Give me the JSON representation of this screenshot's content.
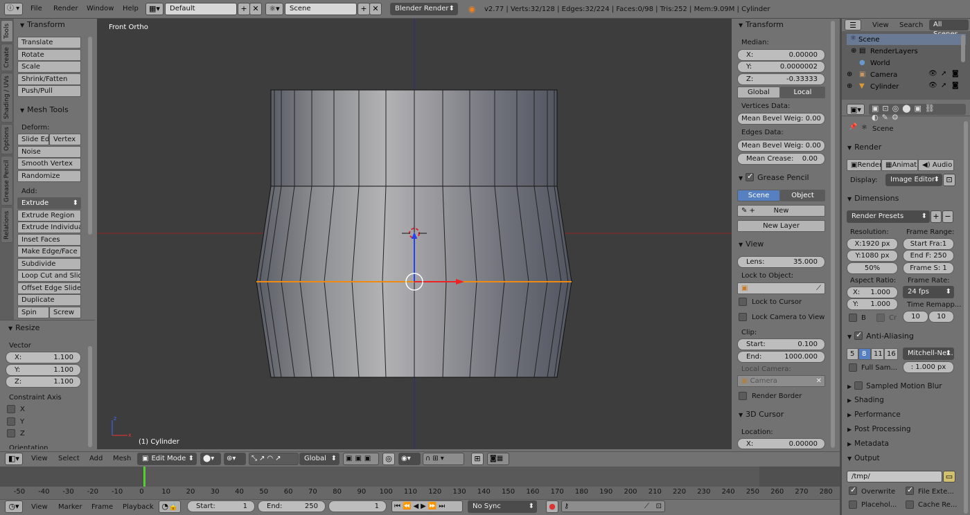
{
  "topbar": {
    "menus": [
      "File",
      "Render",
      "Window",
      "Help"
    ],
    "screen_layout": "Default",
    "scene": "Scene",
    "engine": "Blender Render",
    "stats": "v2.77 | Verts:32/128 | Edges:32/224 | Faces:0/98 | Tris:252 | Mem:9.09M | Cylinder"
  },
  "vtabs": [
    "Tools",
    "Create",
    "Shading / UVs",
    "Options",
    "Grease Pencil",
    "Relations"
  ],
  "toolshelf": {
    "transform_title": "Transform",
    "transform_buttons": [
      "Translate",
      "Rotate",
      "Scale",
      "Shrink/Fatten",
      "Push/Pull"
    ],
    "mesh_tools_title": "Mesh Tools",
    "deform_label": "Deform:",
    "slide_edge": "Slide Ed",
    "vertex": "Vertex",
    "deform_buttons": [
      "Noise",
      "Smooth Vertex",
      "Randomize"
    ],
    "add_label": "Add:",
    "extrude": "Extrude",
    "add_buttons": [
      "Extrude Region",
      "Extrude Individual",
      "Inset Faces",
      "Make Edge/Face",
      "Subdivide",
      "Loop Cut and Slide",
      "Offset Edge Slide",
      "Duplicate"
    ],
    "spin": "Spin",
    "screw": "Screw"
  },
  "operator": {
    "title": "Resize",
    "vector_label": "Vector",
    "x_label": "X:",
    "x_value": "1.100",
    "y_label": "Y:",
    "y_value": "1.100",
    "z_label": "Z:",
    "z_value": "1.100",
    "constraint_label": "Constraint Axis",
    "axes": [
      "X",
      "Y",
      "Z"
    ],
    "orientation_label": "Orientation"
  },
  "viewport": {
    "view_name": "Front Ortho",
    "object_label": "(1) Cylinder"
  },
  "npanel": {
    "transform_title": "Transform",
    "median_label": "Median:",
    "x_label": "X:",
    "x_value": "0.00000",
    "y_label": "Y:",
    "y_value": "0.0000002",
    "z_label": "Z:",
    "z_value": "-0.33333",
    "global": "Global",
    "local": "Local",
    "vertices_data": "Vertices Data:",
    "mean_bevel_v": "Mean Bevel Weig: 0.00",
    "edges_data": "Edges Data:",
    "mean_bevel_e": "Mean Bevel Weig: 0.00",
    "mean_crease_label": "Mean Crease:",
    "mean_crease_value": "0.00",
    "grease_title": "Grease Pencil",
    "scene_btn": "Scene",
    "object_btn": "Object",
    "new_btn": "New",
    "new_layer_btn": "New Layer",
    "view_title": "View",
    "lens_label": "Lens:",
    "lens_value": "35.000",
    "lock_object_label": "Lock to Object:",
    "lock_cursor": "Lock to Cursor",
    "lock_camera": "Lock Camera to View",
    "clip_label": "Clip:",
    "start_label": "Start:",
    "start_value": "0.100",
    "end_label": "End:",
    "end_value": "1000.000",
    "local_camera_label": "Local Camera:",
    "camera_field": "Camera",
    "render_border": "Render Border",
    "cursor_title": "3D Cursor",
    "location_label": "Location:",
    "cx_label": "X:",
    "cx_value": "0.00000"
  },
  "outliner": {
    "view": "View",
    "search": "Search",
    "all_scenes": "All Scenes",
    "items": [
      "Scene",
      "RenderLayers",
      "World",
      "Camera",
      "Cylinder"
    ]
  },
  "props": {
    "scene": "Scene",
    "render_title": "Render",
    "render_btn": "Render",
    "anim_btn": "Animati",
    "audio_btn": "Audio",
    "display_label": "Display:",
    "display_value": "Image Editor",
    "dimensions_title": "Dimensions",
    "presets": "Render Presets",
    "resolution_label": "Resolution:",
    "res_x": "X:1920 px",
    "res_y": "Y:1080 px",
    "res_pct": "50%",
    "frame_range_label": "Frame Range:",
    "start_frame": "Start Fra:1",
    "end_frame": "End F: 250",
    "frame_step": "Frame S: 1",
    "aspect_label": "Aspect Ratio:",
    "asp_x_label": "X:",
    "asp_x_value": "1.000",
    "asp_y_label": "Y:",
    "asp_y_value": "1.000",
    "frame_rate_label": "Frame Rate:",
    "fps": "24 fps",
    "time_remap_label": "Time Remapp...",
    "remap_old": "10",
    "remap_new": "10",
    "b_label": "B",
    "cr_label": "Cr",
    "aa_title": "Anti-Aliasing",
    "aa_samples": [
      "5",
      "8",
      "11",
      "16"
    ],
    "aa_filter": "Mitchell-Ne...",
    "full_sample": "Full Sam...",
    "filter_size": ": 1.000 px",
    "motion_blur": "Sampled Motion Blur",
    "shading": "Shading",
    "performance": "Performance",
    "post_processing": "Post Processing",
    "metadata": "Metadata",
    "output": "Output",
    "output_path": "/tmp/",
    "overwrite": "Overwrite",
    "file_ext": "File Exte...",
    "placeholders": "Placehol...",
    "cache_result": "Cache Re..."
  },
  "vheader": {
    "view": "View",
    "select": "Select",
    "add": "Add",
    "mesh": "Mesh",
    "mode": "Edit Mode",
    "orientation": "Global"
  },
  "timeline": {
    "ticks": [
      "-50",
      "-40",
      "-30",
      "-20",
      "-10",
      "0",
      "10",
      "20",
      "30",
      "40",
      "50",
      "60",
      "70",
      "80",
      "90",
      "100",
      "110",
      "120",
      "130",
      "140",
      "150",
      "160",
      "170",
      "180",
      "190",
      "200",
      "210",
      "220",
      "230",
      "240",
      "250",
      "260",
      "270",
      "280"
    ],
    "view": "View",
    "marker": "Marker",
    "frame": "Frame",
    "playback": "Playback",
    "start_label": "Start:",
    "start_value": "1",
    "end_label": "End:",
    "end_value": "250",
    "current": "1",
    "sync": "No Sync"
  }
}
